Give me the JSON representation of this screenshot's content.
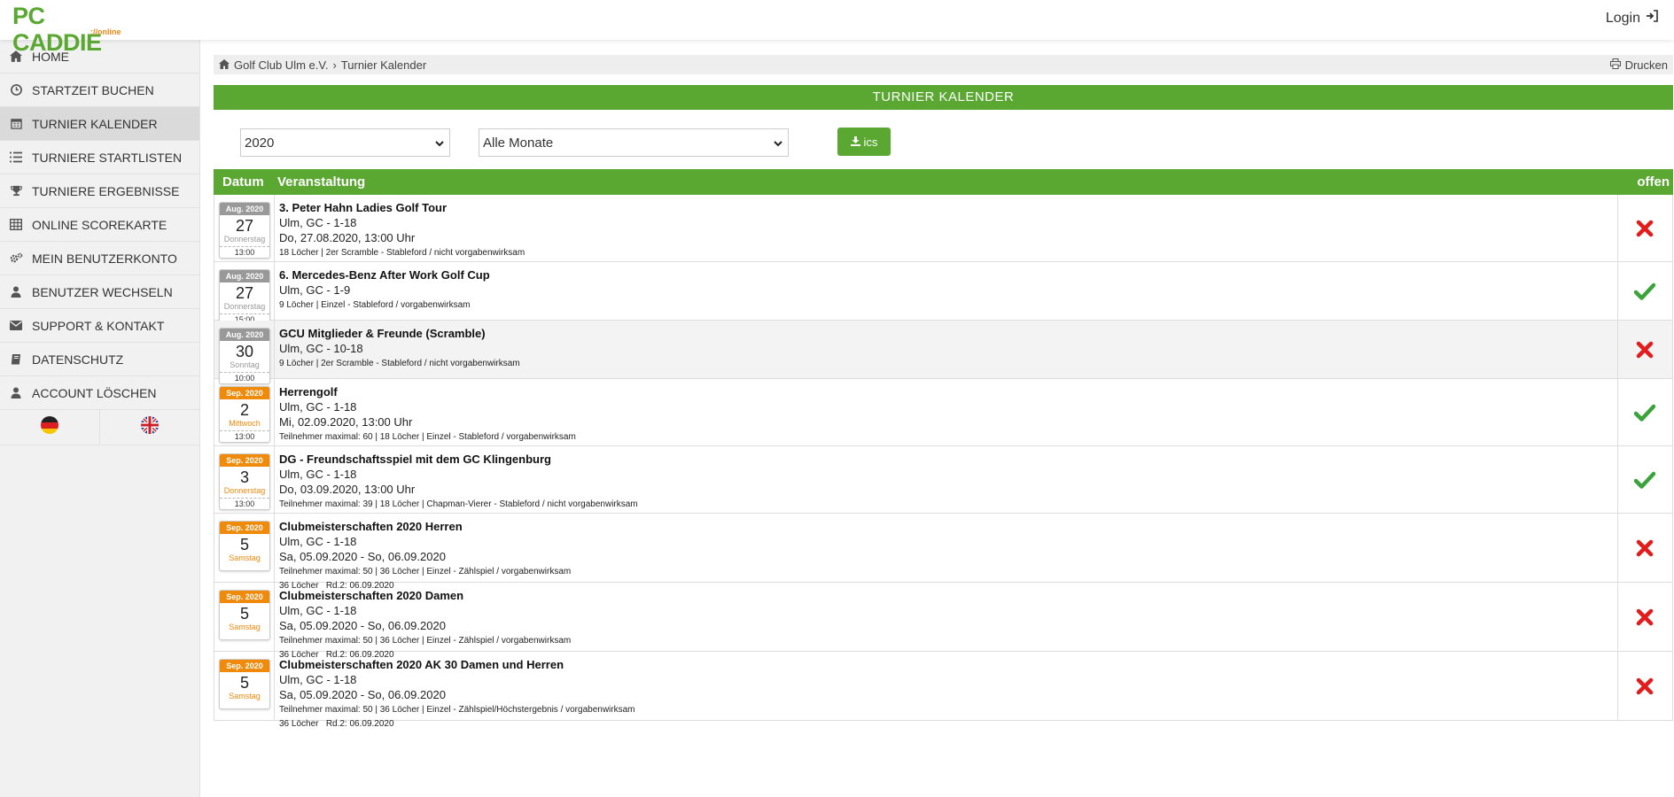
{
  "header": {
    "logo_main": "PC CADDIE",
    "logo_sub": "://online",
    "login_label": "Login"
  },
  "sidebar": {
    "items": [
      {
        "label": "HOME",
        "icon": "home-icon"
      },
      {
        "label": "STARTZEIT BUCHEN",
        "icon": "clock-icon"
      },
      {
        "label": "TURNIER KALENDER",
        "icon": "calendar-icon",
        "active": true
      },
      {
        "label": "TURNIERE STARTLISTEN",
        "icon": "list-icon"
      },
      {
        "label": "TURNIERE ERGEBNISSE",
        "icon": "trophy-icon"
      },
      {
        "label": "ONLINE SCOREKARTE",
        "icon": "table-icon"
      },
      {
        "label": "MEIN BENUTZERKONTO",
        "icon": "gears-icon"
      },
      {
        "label": "BENUTZER WECHSELN",
        "icon": "user-icon"
      },
      {
        "label": "SUPPORT & KONTAKT",
        "icon": "envelope-icon"
      },
      {
        "label": "DATENSCHUTZ",
        "icon": "book-icon"
      },
      {
        "label": "ACCOUNT LÖSCHEN",
        "icon": "user-icon"
      }
    ],
    "flags": [
      "german-flag-icon",
      "uk-flag-icon"
    ]
  },
  "breadcrumb": {
    "club": "Golf Club Ulm e.V.",
    "separator": "›",
    "current": "Turnier Kalender",
    "print_label": "Drucken"
  },
  "page_title": "TURNIER KALENDER",
  "filters": {
    "year": "2020",
    "month": "Alle Monate",
    "ics_label": "ics"
  },
  "table": {
    "col_datum": "Datum",
    "col_event": "Veranstaltung",
    "col_offen": "offen",
    "rows": [
      {
        "month": "Aug. 2020",
        "day": "27",
        "weekday": "Donnerstag",
        "time": "13:00",
        "past": true,
        "title": "3. Peter Hahn Ladies Golf Tour",
        "course": "Ulm, GC - 1-18",
        "date": "Do, 27.08.2020, 13:00 Uhr",
        "details": "18 Löcher | 2er Scramble - Stableford / nicht vorgabenwirksam",
        "extra": "",
        "open": false
      },
      {
        "month": "Aug. 2020",
        "day": "27",
        "weekday": "Donnerstag",
        "time": "15:00",
        "past": true,
        "title": "6. Mercedes-Benz After Work Golf Cup",
        "course": "Ulm, GC - 1-9",
        "date": "",
        "details": "9 Löcher | Einzel - Stableford / vorgabenwirksam",
        "extra": "",
        "open": true
      },
      {
        "month": "Aug. 2020",
        "day": "30",
        "weekday": "Sonntag",
        "time": "10:00",
        "past": true,
        "title": "GCU Mitglieder & Freunde (Scramble)",
        "course": "Ulm, GC - 10-18",
        "date": "",
        "details": "9 Löcher | 2er Scramble - Stableford / nicht vorgabenwirksam",
        "extra": "",
        "open": false
      },
      {
        "month": "Sep. 2020",
        "day": "2",
        "weekday": "Mittwoch",
        "time": "13:00",
        "past": false,
        "title": "Herrengolf",
        "course": "Ulm, GC - 1-18",
        "date": "Mi, 02.09.2020, 13:00 Uhr",
        "details": "Teilnehmer maximal: 60 | 18 Löcher | Einzel - Stableford / vorgabenwirksam",
        "extra": "",
        "open": true
      },
      {
        "month": "Sep. 2020",
        "day": "3",
        "weekday": "Donnerstag",
        "time": "13:00",
        "past": false,
        "title": "DG - Freundschaftsspiel mit dem GC Klingenburg",
        "course": "Ulm, GC - 1-18",
        "date": "Do, 03.09.2020, 13:00 Uhr",
        "details": "Teilnehmer maximal: 39 | 18 Löcher | Chapman-Vierer - Stableford / nicht vorgabenwirksam",
        "extra": "",
        "open": true
      },
      {
        "month": "Sep. 2020",
        "day": "5",
        "weekday": "Samstag",
        "time": "",
        "past": false,
        "title": "Clubmeisterschaften 2020 Herren",
        "course": "Ulm, GC - 1-18",
        "date": "Sa, 05.09.2020 - So, 06.09.2020",
        "details": "Teilnehmer maximal: 50 | 36 Löcher | Einzel - Zählspiel / vorgabenwirksam",
        "extra": "36 Löcher   Rd.2: 06.09.2020",
        "open": false
      },
      {
        "month": "Sep. 2020",
        "day": "5",
        "weekday": "Samstag",
        "time": "",
        "past": false,
        "title": "Clubmeisterschaften 2020 Damen",
        "course": "Ulm, GC - 1-18",
        "date": "Sa, 05.09.2020 - So, 06.09.2020",
        "details": "Teilnehmer maximal: 50 | 36 Löcher | Einzel - Zählspiel / vorgabenwirksam",
        "extra": "36 Löcher   Rd.2: 06.09.2020",
        "open": false
      },
      {
        "month": "Sep. 2020",
        "day": "5",
        "weekday": "Samstag",
        "time": "",
        "past": false,
        "title": "Clubmeisterschaften 2020 AK 30 Damen und Herren",
        "course": "Ulm, GC - 1-18",
        "date": "Sa, 05.09.2020 - So, 06.09.2020",
        "details": "Teilnehmer maximal: 50 | 36 Löcher | Einzel - Zählspiel/Höchstergebnis / vorgabenwirksam",
        "extra": "36 Löcher   Rd.2: 06.09.2020",
        "open": false
      }
    ]
  },
  "colors": {
    "brand_green": "#5aa832",
    "accent_orange": "#ef8a0b",
    "status_closed": "#e31b1b",
    "status_open": "#3aa33a"
  }
}
